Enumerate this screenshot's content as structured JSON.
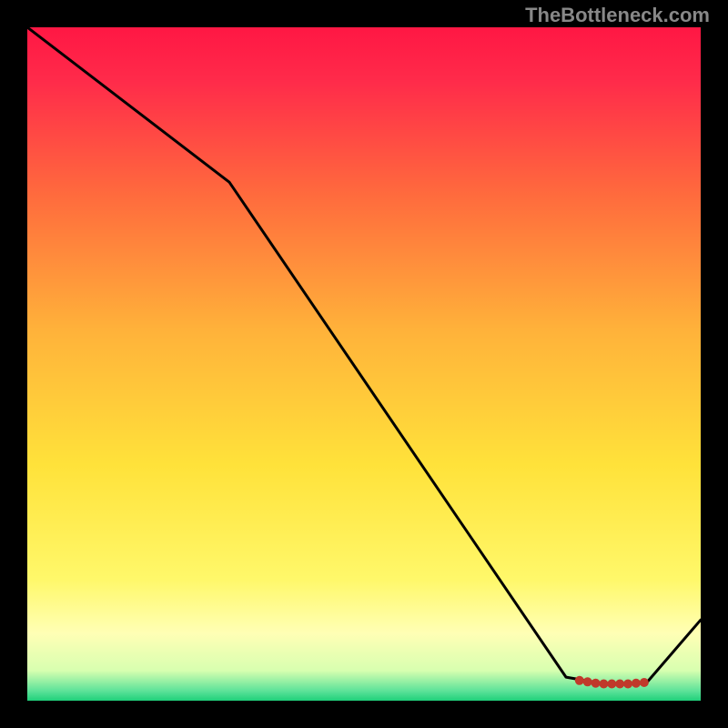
{
  "watermark": "TheBottleneck.com",
  "chart_data": {
    "type": "line",
    "title": "",
    "xlabel": "",
    "ylabel": "",
    "xlim": [
      0,
      100
    ],
    "ylim": [
      0,
      100
    ],
    "x": [
      0,
      30,
      80,
      84,
      86,
      88,
      90,
      92,
      100
    ],
    "values": [
      100,
      77,
      3.5,
      2.8,
      2.5,
      2.5,
      2.5,
      2.7,
      12
    ],
    "markers_x": [
      82,
      83.2,
      84.4,
      85.6,
      86.8,
      88,
      89.2,
      90.4,
      91.6
    ],
    "markers_y": [
      3.0,
      2.8,
      2.6,
      2.5,
      2.5,
      2.5,
      2.5,
      2.6,
      2.7
    ],
    "marker_color": "#c0392b",
    "line_color": "#000000",
    "gradient_stops": [
      {
        "offset": 0.0,
        "color": "#ff1744"
      },
      {
        "offset": 0.08,
        "color": "#ff2b4a"
      },
      {
        "offset": 0.25,
        "color": "#ff6b3d"
      },
      {
        "offset": 0.45,
        "color": "#ffb23a"
      },
      {
        "offset": 0.65,
        "color": "#ffe23a"
      },
      {
        "offset": 0.82,
        "color": "#fff86a"
      },
      {
        "offset": 0.9,
        "color": "#ffffb5"
      },
      {
        "offset": 0.955,
        "color": "#d8ffb0"
      },
      {
        "offset": 0.985,
        "color": "#5fe39a"
      },
      {
        "offset": 1.0,
        "color": "#1fd07a"
      }
    ]
  }
}
